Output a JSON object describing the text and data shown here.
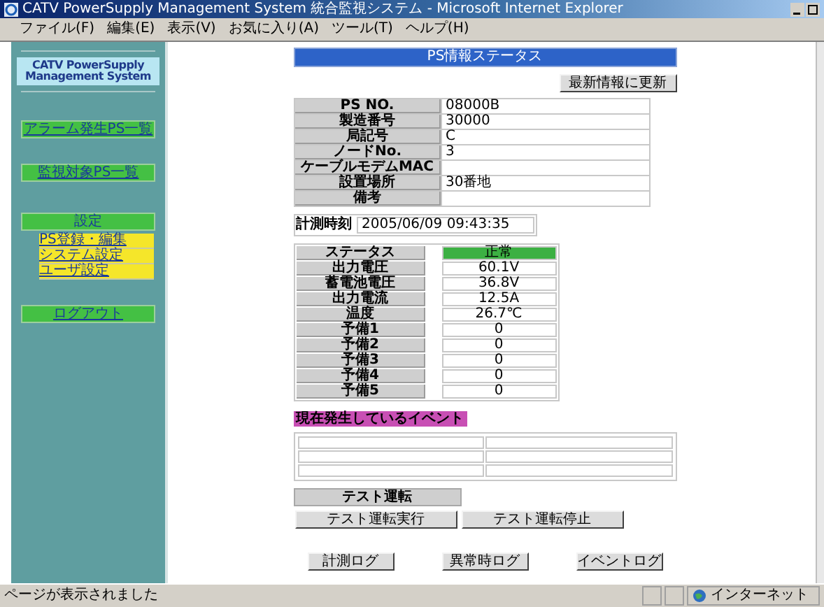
{
  "window": {
    "title": "CATV PowerSupply Management System 統合監視システム - Microsoft Internet Explorer",
    "menu": [
      "ファイル(F)",
      "編集(E)",
      "表示(V)",
      "お気に入り(A)",
      "ツール(T)",
      "ヘルプ(H)"
    ]
  },
  "sidebar": {
    "title": "CATV PowerSupply Management System",
    "items": [
      {
        "label": "アラーム発生PS一覧",
        "kind": "nav"
      },
      {
        "label": "監視対象PS一覧",
        "kind": "nav"
      },
      {
        "label": "設定",
        "kind": "header"
      },
      {
        "label": "PS登録・編集",
        "kind": "sub"
      },
      {
        "label": "システム設定",
        "kind": "sub"
      },
      {
        "label": "ユーザ設定",
        "kind": "sub"
      },
      {
        "label": "ログアウト",
        "kind": "nav"
      }
    ]
  },
  "page": {
    "heading": "PS情報ステータス",
    "refresh_button": "最新情報に更新",
    "info": [
      {
        "label": "PS NO.",
        "value": "08000B"
      },
      {
        "label": "製造番号",
        "value": "30000"
      },
      {
        "label": "局記号",
        "value": "C"
      },
      {
        "label": "ノードNo.",
        "value": "3"
      },
      {
        "label": "ケーブルモデムMAC"
      },
      {
        "label": "設置場所",
        "value": "30番地"
      },
      {
        "label": "備考"
      }
    ],
    "measured": {
      "label": "計測時刻",
      "value": "2005/06/09 09:43:35"
    },
    "status": [
      {
        "label": "ステータス",
        "value": "正常",
        "kind": "status"
      },
      {
        "label": "出力電圧",
        "value": "60.1V",
        "kind": "reading"
      },
      {
        "label": "蓄電池電圧",
        "value": "36.8V",
        "kind": "reading"
      },
      {
        "label": "出力電流",
        "value": "12.5A",
        "kind": "reading"
      },
      {
        "label": "温度",
        "value": "26.7℃",
        "kind": "reading"
      },
      {
        "label": "予備1",
        "value": "0",
        "kind": "reading"
      },
      {
        "label": "予備2",
        "value": "0",
        "kind": "reading"
      },
      {
        "label": "予備3",
        "value": "0",
        "kind": "reading"
      },
      {
        "label": "予備4",
        "value": "0",
        "kind": "reading"
      },
      {
        "label": "予備5",
        "value": "0",
        "kind": "reading"
      }
    ],
    "events": {
      "title": "現在発生しているイベント"
    },
    "test": {
      "title": "テスト運転",
      "buttons": [
        "テスト運転実行",
        "テスト運転停止"
      ]
    },
    "log_buttons": [
      "計測ログ",
      "異常時ログ",
      "イベントログ"
    ]
  },
  "status_bar": {
    "message": "ページが表示されました",
    "zone": "インターネット"
  }
}
